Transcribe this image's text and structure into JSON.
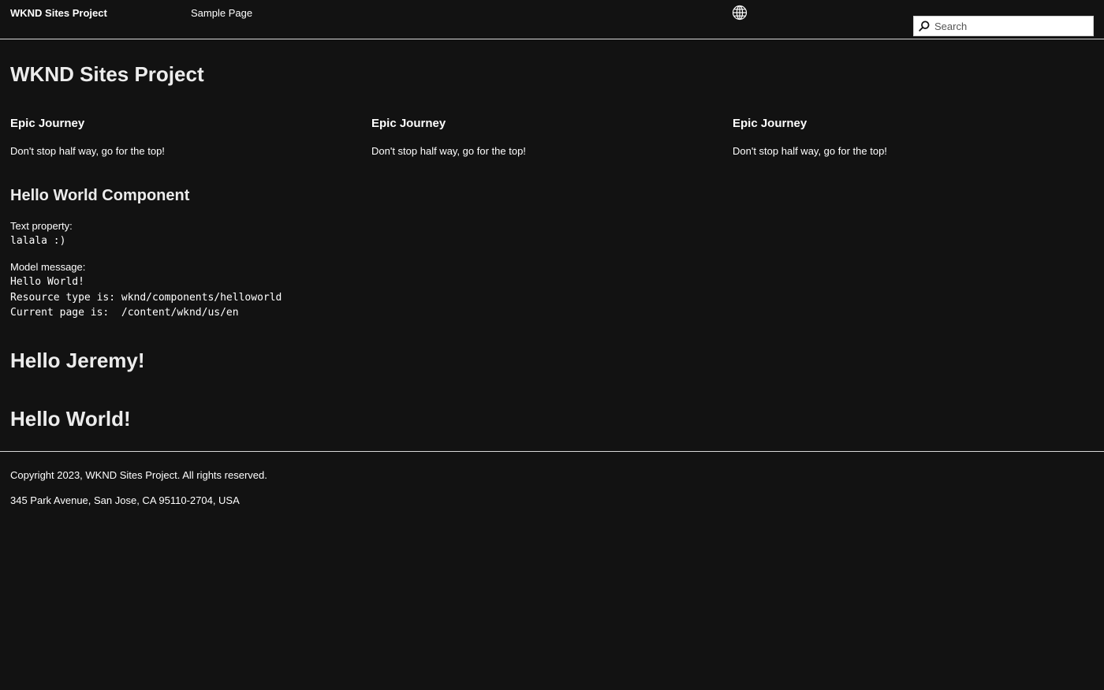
{
  "header": {
    "brand": "WKND Sites Project",
    "nav_link": "Sample Page",
    "language_icon": "globe-icon",
    "search": {
      "placeholder": "Search",
      "icon": "search-icon"
    }
  },
  "main": {
    "title": "WKND Sites Project",
    "teasers": [
      {
        "title": "Epic Journey",
        "description": "Don't stop half way, go for the top!"
      },
      {
        "title": "Epic Journey",
        "description": "Don't stop half way, go for the top!"
      },
      {
        "title": "Epic Journey",
        "description": "Don't stop half way, go for the top!"
      }
    ],
    "hello_world": {
      "title": "Hello World Component",
      "text_property_label": "Text property:",
      "text_property_value": "lalala :)",
      "model_message_label": "Model message:",
      "model_lines": [
        "Hello World!",
        "Resource type is: wknd/components/helloworld",
        "Current page is:  /content/wknd/us/en"
      ]
    },
    "greeting_1": "Hello Jeremy!",
    "greeting_2": "Hello World!"
  },
  "footer": {
    "copyright": "Copyright 2023, WKND Sites Project. All rights reserved.",
    "address": "345 Park Avenue, San Jose, CA 95110-2704, USA"
  },
  "colors": {
    "background": "#121212",
    "text": "#ffffff",
    "divider": "#d8d8d8"
  }
}
